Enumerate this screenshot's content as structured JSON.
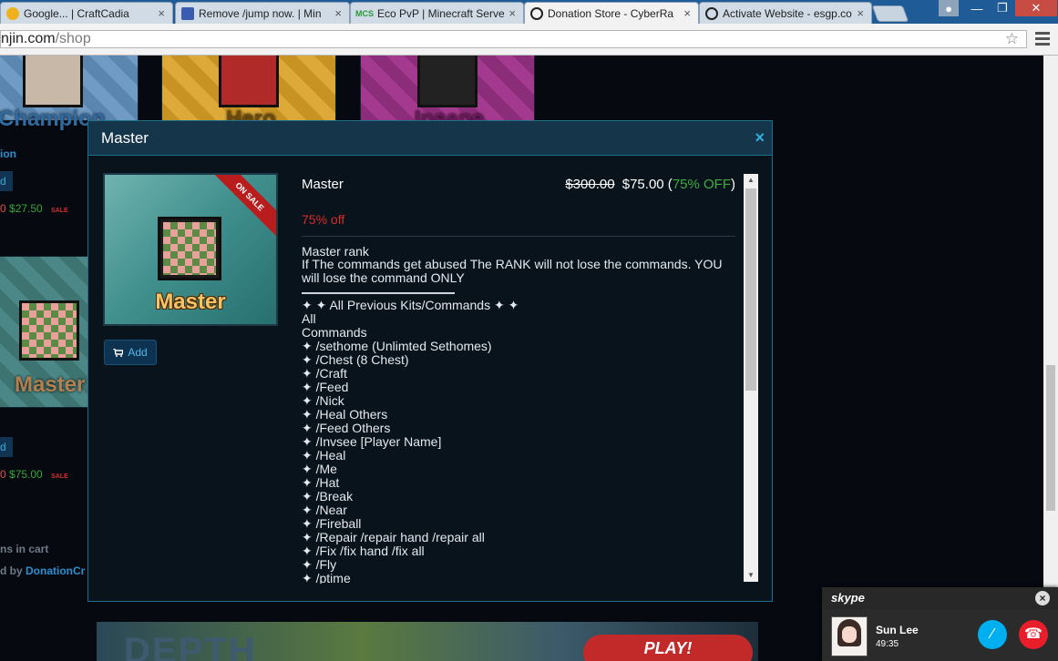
{
  "browser": {
    "tabs": [
      {
        "label": "Google... | CraftCadia",
        "favicon": "craftcadia-icon",
        "active": false
      },
      {
        "label": "Remove /jump now. | Min",
        "favicon": "minecraft-icon",
        "active": false
      },
      {
        "label": "Eco PvP | Minecraft Server",
        "favicon": "mcs-icon",
        "favicon_text": "MCS",
        "active": false
      },
      {
        "label": "Donation Store - CyberRa",
        "favicon": "enjin-icon",
        "active": true
      },
      {
        "label": "Activate Website - esgp.co",
        "favicon": "enjin-icon",
        "active": false
      }
    ],
    "url_domain": "njin.com",
    "url_path": "/shop"
  },
  "background_page": {
    "tiles": [
      "Champion",
      "Hero",
      "Insane"
    ],
    "master_tile": "Master",
    "add_stub": "d",
    "price_row1": {
      "old": "0",
      "new": "$27.50",
      "sale": "SALE"
    },
    "price_row2": {
      "old": "0",
      "new": "$75.00",
      "sale": "SALE"
    },
    "partial_label": "ion",
    "cart_text": "ns in cart",
    "powered_text": "d by ",
    "powered_link": "DonationCr",
    "banner_title": "DEPTH",
    "banner_button": "PLAY!"
  },
  "modal": {
    "title": "Master",
    "close_icon": "×",
    "image_label": "Master",
    "ribbon_text": "ON SALE",
    "add_button": "Add",
    "product_name": "Master",
    "old_price": "$300.00",
    "new_price": "$75.00",
    "discount_paren": "75% OFF",
    "discount_label": "75% off",
    "rank_line": "Master rank",
    "note": "If The commands get abused The RANK will not lose the commands. YOU will lose the command ONLY",
    "lines": [
      "✦ ✦  All Previous Kits/Commands  ✦ ✦",
      "All",
      "Commands",
      "✦ /sethome (Unlimted Sethomes)",
      "✦ /Chest (8 Chest)",
      "✦ /Craft",
      "✦ /Feed",
      "✦ /Nick",
      "✦ /Heal Others",
      "✦ /Feed Others",
      "✦ /Invsee [Player Name]",
      "✦ /Heal",
      "✦ /Me",
      "✦ /Hat",
      "✦ /Break",
      "✦ /Near",
      "✦ /Fireball",
      "✦ /Repair /repair hand /repair all",
      "✦ /Fix /fix hand /fix all",
      "✦ /Fly",
      "✦ /ptime"
    ]
  },
  "skype": {
    "logo": "skype",
    "contact": "Sun Lee",
    "call_time": "49:35"
  },
  "colors": {
    "accent": "#2fb0e0",
    "sale_red": "#d92b2b",
    "off_green": "#3fae3f",
    "modal_border": "#1f6f8a"
  }
}
